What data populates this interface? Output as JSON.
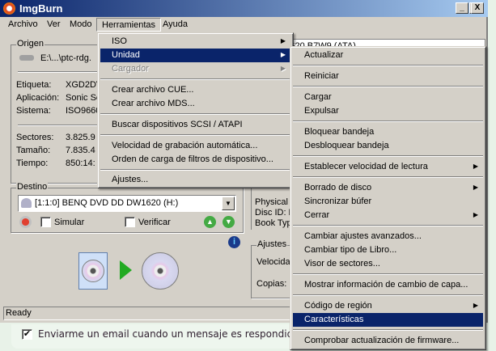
{
  "window": {
    "title": "ImgBurn",
    "minimize": "_",
    "maximize": "□",
    "close": "X"
  },
  "menubar": [
    "Archivo",
    "Ver",
    "Modo",
    "Herramientas",
    "Ayuda"
  ],
  "origen": {
    "label": "Origen",
    "path": "E:\\...\\ptc-rdg.",
    "fields": [
      {
        "k": "Etiqueta:",
        "v": "XGD2DV"
      },
      {
        "k": "Aplicación:",
        "v": "Sonic Sc"
      },
      {
        "k": "Sistema:",
        "v": "ISO9660"
      },
      {
        "k": "Sectores:",
        "v": "3.825.9"
      },
      {
        "k": "Tamaño:",
        "v": "7.835.4"
      },
      {
        "k": "Tiempo:",
        "v": "850:14:"
      }
    ]
  },
  "destino": {
    "label": "Destino",
    "drive": "[1:1:0] BENQ DVD DD DW1620 (H:)",
    "simular": "Simular",
    "verificar": "Verificar"
  },
  "right": {
    "device": "BD-DW1620 B7W9 (ATA)",
    "info": [
      "Physical I",
      "Disc ID: N",
      "Book Typ"
    ],
    "ajustes": "Ajustes",
    "velocidad": "Velocidad",
    "copias": "Copias:"
  },
  "status": "Ready",
  "email": {
    "label": "Enviarme un email cuando un mensaje es respondido",
    "checked": true
  },
  "herramientas_menu": [
    {
      "label": "ISO",
      "sub": true
    },
    {
      "label": "Unidad",
      "sub": true,
      "selected": true
    },
    {
      "label": "Cargador",
      "sub": true,
      "disabled": true
    },
    {
      "label": "Crear archivo CUE..."
    },
    {
      "label": "Crear archivo MDS..."
    },
    {
      "label": "Buscar dispositivos SCSI / ATAPI"
    },
    {
      "label": "Velocidad de grabación automática..."
    },
    {
      "label": "Orden de carga de filtros de dispositivo..."
    },
    {
      "label": "Ajustes..."
    }
  ],
  "unidad_menu": [
    {
      "label": "Actualizar"
    },
    {
      "label": "Reiniciar"
    },
    {
      "label": "Cargar"
    },
    {
      "label": "Expulsar"
    },
    {
      "label": "Bloquear bandeja"
    },
    {
      "label": "Desbloquear bandeja"
    },
    {
      "label": "Establecer velocidad de lectura",
      "sub": true
    },
    {
      "label": "Borrado de disco",
      "sub": true
    },
    {
      "label": "Sincronizar búfer"
    },
    {
      "label": "Cerrar",
      "sub": true
    },
    {
      "label": "Cambiar ajustes avanzados..."
    },
    {
      "label": "Cambiar tipo de Libro..."
    },
    {
      "label": "Visor de sectores..."
    },
    {
      "label": "Mostrar información de cambio de capa..."
    },
    {
      "label": "Código de región",
      "sub": true
    },
    {
      "label": "Características",
      "selected": true
    },
    {
      "label": "Comprobar actualización de firmware..."
    }
  ]
}
